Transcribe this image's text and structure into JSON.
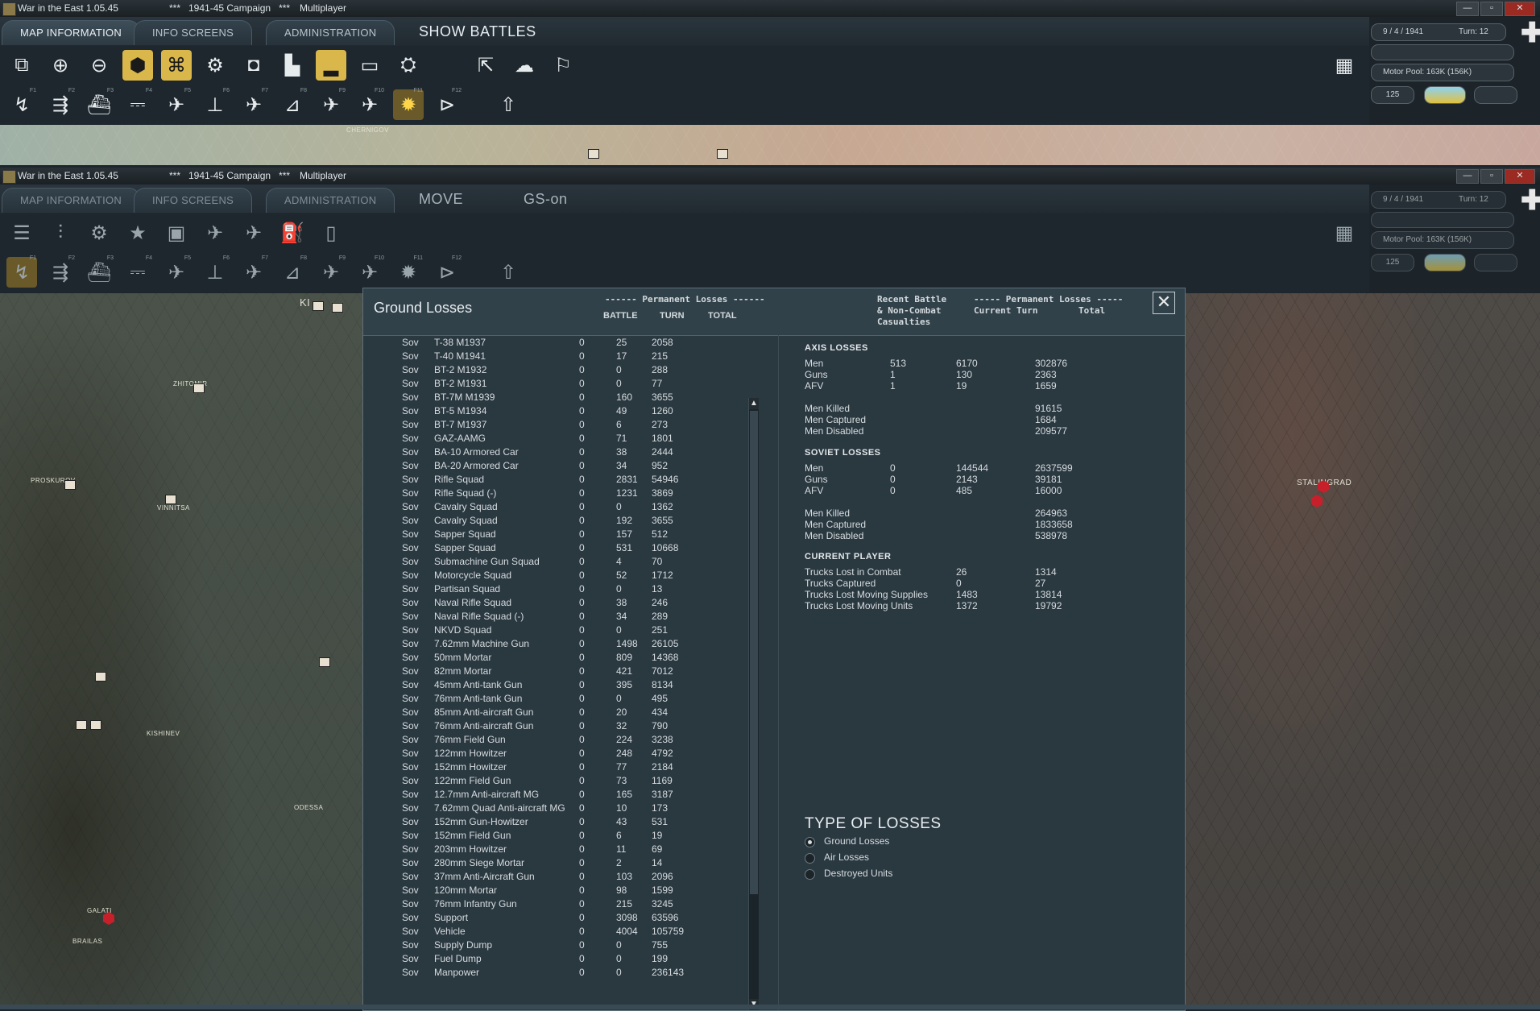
{
  "window": {
    "app": "War in the East 1.05.45",
    "campaign": "***   1941-45 Campaign   ***",
    "mode": "Multiplayer",
    "btn_min": "—",
    "btn_max": "▫",
    "btn_close": "✕"
  },
  "top_bar": {
    "tabs": [
      "MAP INFORMATION",
      "INFO SCREENS",
      "ADMINISTRATION"
    ],
    "action": "SHOW BATTLES"
  },
  "second_bar": {
    "tabs": [
      "MAP INFORMATION",
      "INFO SCREENS",
      "ADMINISTRATION"
    ],
    "action1": "MOVE",
    "action2": "GS-on"
  },
  "fkeys": [
    "F1",
    "F2",
    "F3",
    "F4",
    "F5",
    "F6",
    "F7",
    "F8",
    "F9",
    "F10",
    "F11",
    "F12"
  ],
  "status": {
    "date": "9 / 4 / 1941",
    "turn": "Turn: 12",
    "motor_pool": "Motor Pool:  163K (156K)",
    "count": "125"
  },
  "map": {
    "cities": [
      "CHERNIGOV",
      "ZHITOMIR",
      "PROSKUROV",
      "VINNITSA",
      "KISHINEV",
      "ODESSA",
      "GALATI",
      "BRAILAS",
      "STALINGRAD",
      "KI"
    ]
  },
  "dialog": {
    "title": "Ground Losses",
    "close": "✕",
    "perm_header": "------ Permanent Losses ------",
    "col_battle": "BATTLE",
    "col_turn": "TURN",
    "col_total": "TOTAL",
    "recent_1": "Recent Battle",
    "recent_2": "& Non-Combat",
    "recent_3": "Casualties",
    "perm_header2": "----- Permanent Losses -----",
    "col_current": "Current Turn",
    "col_total2": "Total",
    "rows": [
      [
        "Sov",
        "T-38 M1937",
        "0",
        "25",
        "2058"
      ],
      [
        "Sov",
        "T-40 M1941",
        "0",
        "17",
        "215"
      ],
      [
        "Sov",
        "BT-2 M1932",
        "0",
        "0",
        "288"
      ],
      [
        "Sov",
        "BT-2 M1931",
        "0",
        "0",
        "77"
      ],
      [
        "Sov",
        "BT-7M M1939",
        "0",
        "160",
        "3655"
      ],
      [
        "Sov",
        "BT-5 M1934",
        "0",
        "49",
        "1260"
      ],
      [
        "Sov",
        "BT-7 M1937",
        "0",
        "6",
        "273"
      ],
      [
        "Sov",
        "GAZ-AAMG",
        "0",
        "71",
        "1801"
      ],
      [
        "Sov",
        "BA-10 Armored Car",
        "0",
        "38",
        "2444"
      ],
      [
        "Sov",
        "BA-20 Armored Car",
        "0",
        "34",
        "952"
      ],
      [
        "Sov",
        "Rifle Squad",
        "0",
        "2831",
        "54946"
      ],
      [
        "Sov",
        "Rifle Squad (-)",
        "0",
        "1231",
        "3869"
      ],
      [
        "Sov",
        "Cavalry Squad",
        "0",
        "0",
        "1362"
      ],
      [
        "Sov",
        "Cavalry Squad",
        "0",
        "192",
        "3655"
      ],
      [
        "Sov",
        "Sapper Squad",
        "0",
        "157",
        "512"
      ],
      [
        "Sov",
        "Sapper Squad",
        "0",
        "531",
        "10668"
      ],
      [
        "Sov",
        "Submachine Gun Squad",
        "0",
        "4",
        "70"
      ],
      [
        "Sov",
        "Motorcycle Squad",
        "0",
        "52",
        "1712"
      ],
      [
        "Sov",
        "Partisan Squad",
        "0",
        "0",
        "13"
      ],
      [
        "Sov",
        "Naval Rifle Squad",
        "0",
        "38",
        "246"
      ],
      [
        "Sov",
        "Naval Rifle Squad (-)",
        "0",
        "34",
        "289"
      ],
      [
        "Sov",
        "NKVD Squad",
        "0",
        "0",
        "251"
      ],
      [
        "Sov",
        "7.62mm Machine Gun",
        "0",
        "1498",
        "26105"
      ],
      [
        "Sov",
        "50mm Mortar",
        "0",
        "809",
        "14368"
      ],
      [
        "Sov",
        "82mm Mortar",
        "0",
        "421",
        "7012"
      ],
      [
        "Sov",
        "45mm Anti-tank Gun",
        "0",
        "395",
        "8134"
      ],
      [
        "Sov",
        "76mm Anti-tank Gun",
        "0",
        "0",
        "495"
      ],
      [
        "Sov",
        "85mm Anti-aircraft Gun",
        "0",
        "20",
        "434"
      ],
      [
        "Sov",
        "76mm Anti-aircraft Gun",
        "0",
        "32",
        "790"
      ],
      [
        "Sov",
        "76mm Field Gun",
        "0",
        "224",
        "3238"
      ],
      [
        "Sov",
        "122mm Howitzer",
        "0",
        "248",
        "4792"
      ],
      [
        "Sov",
        "152mm Howitzer",
        "0",
        "77",
        "2184"
      ],
      [
        "Sov",
        "122mm Field Gun",
        "0",
        "73",
        "1169"
      ],
      [
        "Sov",
        "12.7mm Anti-aircraft MG",
        "0",
        "165",
        "3187"
      ],
      [
        "Sov",
        "7.62mm Quad Anti-aircraft MG",
        "0",
        "10",
        "173"
      ],
      [
        "Sov",
        "152mm Gun-Howitzer",
        "0",
        "43",
        "531"
      ],
      [
        "Sov",
        "152mm Field Gun",
        "0",
        "6",
        "19"
      ],
      [
        "Sov",
        "203mm Howitzer",
        "0",
        "11",
        "69"
      ],
      [
        "Sov",
        "280mm Siege Mortar",
        "0",
        "2",
        "14"
      ],
      [
        "Sov",
        "37mm Anti-Aircraft Gun",
        "0",
        "103",
        "2096"
      ],
      [
        "Sov",
        "120mm Mortar",
        "0",
        "98",
        "1599"
      ],
      [
        "Sov",
        "76mm Infantry Gun",
        "0",
        "215",
        "3245"
      ],
      [
        "Sov",
        "Support",
        "0",
        "3098",
        "63596"
      ],
      [
        "Sov",
        "Vehicle",
        "0",
        "4004",
        "105759"
      ],
      [
        "Sov",
        "Supply Dump",
        "0",
        "0",
        "755"
      ],
      [
        "Sov",
        "Fuel Dump",
        "0",
        "0",
        "199"
      ],
      [
        "Sov",
        "Manpower",
        "0",
        "0",
        "236143"
      ]
    ],
    "axis": {
      "title": "AXIS LOSSES",
      "rows": [
        [
          "Men",
          "513",
          "6170",
          "302876"
        ],
        [
          "Guns",
          "1",
          "130",
          "2363"
        ],
        [
          "AFV",
          "1",
          "19",
          "1659"
        ]
      ],
      "detail": [
        [
          "Men Killed",
          "91615"
        ],
        [
          "Men Captured",
          "1684"
        ],
        [
          "Men Disabled",
          "209577"
        ]
      ]
    },
    "soviet": {
      "title": "SOVIET LOSSES",
      "rows": [
        [
          "Men",
          "0",
          "144544",
          "2637599"
        ],
        [
          "Guns",
          "0",
          "2143",
          "39181"
        ],
        [
          "AFV",
          "0",
          "485",
          "16000"
        ]
      ],
      "detail": [
        [
          "Men Killed",
          "264963"
        ],
        [
          "Men Captured",
          "1833658"
        ],
        [
          "Men Disabled",
          "538978"
        ]
      ]
    },
    "player": {
      "title": "CURRENT PLAYER",
      "rows": [
        [
          "Trucks Lost in Combat",
          "26",
          "1314"
        ],
        [
          "Trucks Captured",
          "0",
          "27"
        ],
        [
          "Trucks Lost Moving Supplies",
          "1483",
          "13814"
        ],
        [
          "Trucks Lost Moving Units",
          "1372",
          "19792"
        ]
      ]
    },
    "type_title": "TYPE OF LOSSES",
    "types": [
      "Ground Losses",
      "Air Losses",
      "Destroyed Units"
    ],
    "selected_type": "Ground Losses"
  },
  "colors": {
    "highlight": "#d9b74a",
    "panel": "#2a3840",
    "header": "#31414a"
  }
}
